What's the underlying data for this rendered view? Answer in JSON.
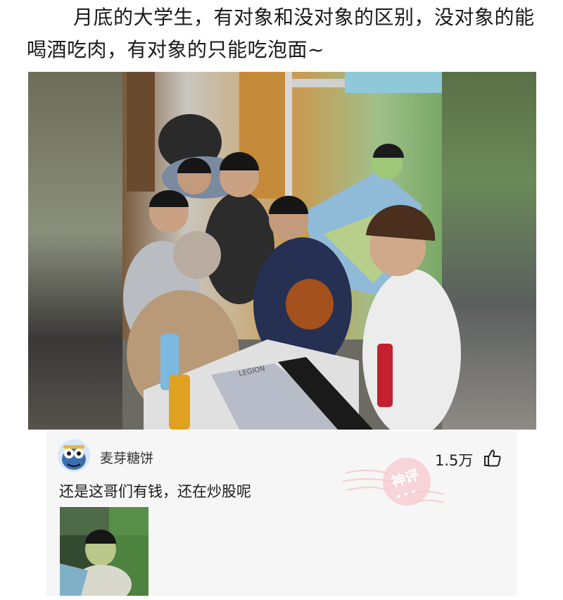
{
  "post": {
    "caption": "月底的大学生，有对象和没对象的区别，没对象的能喝酒吃肉，有对象的只能吃泡面~",
    "laptop_brand": "LEGION"
  },
  "comment": {
    "username": "麦芽糖饼",
    "like_count": "1.5万",
    "text": "还是这哥们有钱，还在炒股呢",
    "stamp_label": "神评"
  },
  "icons": {
    "like": "thumbs-up-icon",
    "avatar": "cartoon-avatar"
  },
  "colors": {
    "stamp": "#f2a0a8",
    "comment_bg": "#f6f6f6"
  }
}
